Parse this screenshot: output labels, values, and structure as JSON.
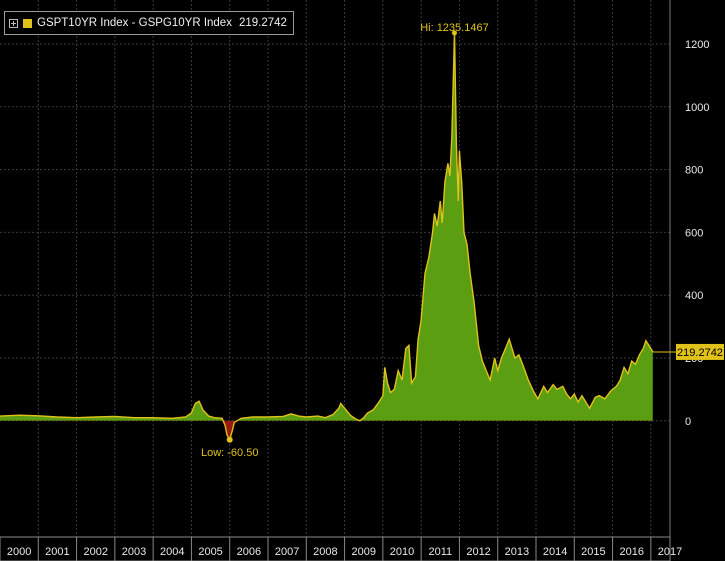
{
  "legend": {
    "series_name": "GSPT10YR Index - GSPG10YR Index",
    "last_value": "219.2742",
    "color": "#e0c21a"
  },
  "colors": {
    "background": "#000000",
    "line": "#e0c21a",
    "fill_positive": "#5b9e12",
    "fill_negative": "#9a1a10",
    "grid": "#3a3a3a",
    "axis_text": "#e8e8e8",
    "label_bg": "#e0c21a",
    "annotation_text": "#e0c21a"
  },
  "chart_data": {
    "type": "area",
    "title": "",
    "xlabel": "",
    "ylabel": "",
    "y_ticks": [
      0,
      200,
      400,
      600,
      800,
      1000,
      1200
    ],
    "ylim": [
      -370,
      1340
    ],
    "xlim": [
      2000.0,
      2017.5
    ],
    "x_ticks": [
      "2000",
      "2001",
      "2002",
      "2003",
      "2004",
      "2005",
      "2006",
      "2007",
      "2008",
      "2009",
      "2010",
      "2011",
      "2012",
      "2013",
      "2014",
      "2015",
      "2016",
      "2017"
    ],
    "grid": true,
    "legend_position": "top-left",
    "annotations": {
      "high": {
        "label": "Hi: 1235.1467",
        "x": 2011.87,
        "y": 1235.1467
      },
      "low": {
        "label": "Low: -60.50",
        "x": 2006.0,
        "y": -60.5
      },
      "last": {
        "label": "219.2742",
        "x": 2017.05,
        "y": 219.2742
      }
    },
    "series": [
      {
        "name": "GSPT10YR Index - GSPG10YR Index",
        "points": [
          [
            2000.0,
            15
          ],
          [
            2000.5,
            18
          ],
          [
            2001.0,
            16
          ],
          [
            2001.5,
            12
          ],
          [
            2002.0,
            10
          ],
          [
            2002.5,
            12
          ],
          [
            2003.0,
            14
          ],
          [
            2003.5,
            10
          ],
          [
            2004.0,
            10
          ],
          [
            2004.5,
            8
          ],
          [
            2004.85,
            12
          ],
          [
            2005.0,
            25
          ],
          [
            2005.1,
            55
          ],
          [
            2005.2,
            62
          ],
          [
            2005.3,
            35
          ],
          [
            2005.45,
            15
          ],
          [
            2005.6,
            10
          ],
          [
            2005.8,
            8
          ],
          [
            2005.88,
            -15
          ],
          [
            2005.93,
            -45
          ],
          [
            2006.0,
            -60.5
          ],
          [
            2006.07,
            -30
          ],
          [
            2006.12,
            -5
          ],
          [
            2006.3,
            8
          ],
          [
            2006.6,
            12
          ],
          [
            2007.0,
            12
          ],
          [
            2007.4,
            14
          ],
          [
            2007.6,
            22
          ],
          [
            2007.8,
            15
          ],
          [
            2008.0,
            12
          ],
          [
            2008.3,
            15
          ],
          [
            2008.5,
            10
          ],
          [
            2008.7,
            20
          ],
          [
            2008.85,
            40
          ],
          [
            2008.9,
            55
          ],
          [
            2009.0,
            40
          ],
          [
            2009.15,
            18
          ],
          [
            2009.3,
            5
          ],
          [
            2009.4,
            0
          ],
          [
            2009.5,
            10
          ],
          [
            2009.6,
            25
          ],
          [
            2009.75,
            35
          ],
          [
            2009.9,
            60
          ],
          [
            2010.0,
            80
          ],
          [
            2010.05,
            170
          ],
          [
            2010.12,
            120
          ],
          [
            2010.2,
            90
          ],
          [
            2010.3,
            100
          ],
          [
            2010.4,
            160
          ],
          [
            2010.5,
            130
          ],
          [
            2010.6,
            230
          ],
          [
            2010.68,
            240
          ],
          [
            2010.75,
            120
          ],
          [
            2010.85,
            140
          ],
          [
            2010.92,
            260
          ],
          [
            2011.0,
            320
          ],
          [
            2011.1,
            470
          ],
          [
            2011.2,
            520
          ],
          [
            2011.3,
            600
          ],
          [
            2011.35,
            660
          ],
          [
            2011.42,
            620
          ],
          [
            2011.5,
            700
          ],
          [
            2011.55,
            630
          ],
          [
            2011.62,
            760
          ],
          [
            2011.7,
            820
          ],
          [
            2011.75,
            780
          ],
          [
            2011.8,
            900
          ],
          [
            2011.87,
            1235.1467
          ],
          [
            2011.92,
            880
          ],
          [
            2011.97,
            700
          ],
          [
            2012.0,
            860
          ],
          [
            2012.06,
            760
          ],
          [
            2012.12,
            600
          ],
          [
            2012.2,
            560
          ],
          [
            2012.28,
            470
          ],
          [
            2012.38,
            380
          ],
          [
            2012.5,
            240
          ],
          [
            2012.6,
            190
          ],
          [
            2012.7,
            160
          ],
          [
            2012.8,
            130
          ],
          [
            2012.92,
            200
          ],
          [
            2013.0,
            160
          ],
          [
            2013.1,
            200
          ],
          [
            2013.2,
            230
          ],
          [
            2013.3,
            260
          ],
          [
            2013.35,
            240
          ],
          [
            2013.45,
            200
          ],
          [
            2013.55,
            210
          ],
          [
            2013.65,
            180
          ],
          [
            2013.8,
            130
          ],
          [
            2013.95,
            90
          ],
          [
            2014.05,
            70
          ],
          [
            2014.2,
            110
          ],
          [
            2014.3,
            90
          ],
          [
            2014.45,
            115
          ],
          [
            2014.55,
            100
          ],
          [
            2014.7,
            110
          ],
          [
            2014.8,
            85
          ],
          [
            2014.9,
            70
          ],
          [
            2015.0,
            85
          ],
          [
            2015.1,
            60
          ],
          [
            2015.2,
            80
          ],
          [
            2015.3,
            60
          ],
          [
            2015.4,
            40
          ],
          [
            2015.55,
            75
          ],
          [
            2015.65,
            80
          ],
          [
            2015.8,
            70
          ],
          [
            2015.95,
            95
          ],
          [
            2016.1,
            110
          ],
          [
            2016.2,
            130
          ],
          [
            2016.3,
            170
          ],
          [
            2016.4,
            150
          ],
          [
            2016.5,
            190
          ],
          [
            2016.6,
            180
          ],
          [
            2016.7,
            210
          ],
          [
            2016.8,
            230
          ],
          [
            2016.87,
            255
          ],
          [
            2016.95,
            240
          ],
          [
            2017.05,
            219.2742
          ]
        ]
      }
    ]
  }
}
